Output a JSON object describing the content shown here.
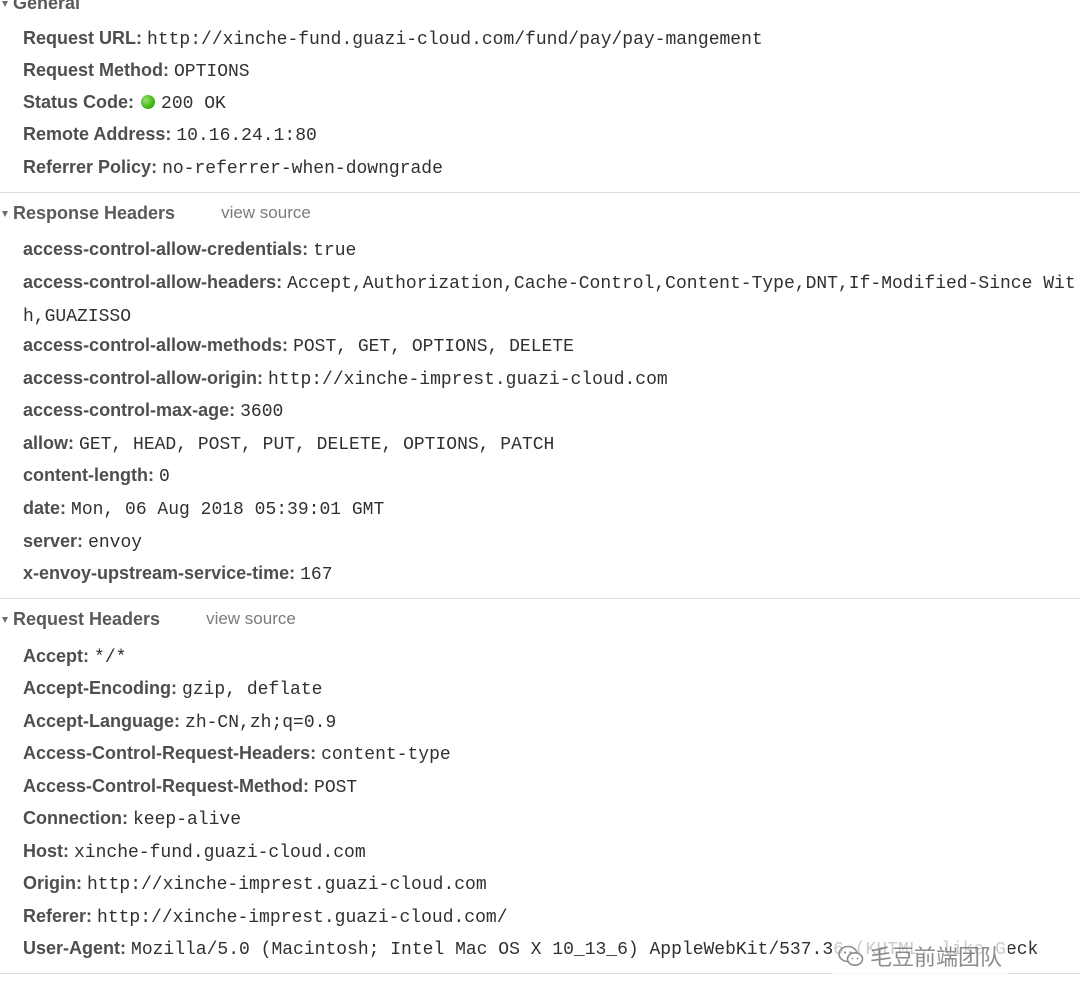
{
  "general": {
    "title": "General",
    "rows": [
      {
        "key": "Request URL:",
        "value": "http://xinche-fund.guazi-cloud.com/fund/pay/pay-mangement"
      },
      {
        "key": "Request Method:",
        "value": "OPTIONS"
      },
      {
        "key": "Status Code:",
        "value": "200 OK"
      },
      {
        "key": "Remote Address:",
        "value": "10.16.24.1:80"
      },
      {
        "key": "Referrer Policy:",
        "value": "no-referrer-when-downgrade"
      }
    ],
    "status_color": "#44b91e"
  },
  "response_headers": {
    "title": "Response Headers",
    "view_source": "view source",
    "rows": [
      {
        "key": "access-control-allow-credentials:",
        "value": "true"
      },
      {
        "key": "access-control-allow-headers:",
        "value": "Accept,Authorization,Cache-Control,Content-Type,DNT,If-Modified-Since With,GUAZISSO"
      },
      {
        "key": "access-control-allow-methods:",
        "value": "POST, GET, OPTIONS, DELETE"
      },
      {
        "key": "access-control-allow-origin:",
        "value": "http://xinche-imprest.guazi-cloud.com"
      },
      {
        "key": "access-control-max-age:",
        "value": "3600"
      },
      {
        "key": "allow:",
        "value": "GET, HEAD, POST, PUT, DELETE, OPTIONS, PATCH"
      },
      {
        "key": "content-length:",
        "value": "0"
      },
      {
        "key": "date:",
        "value": "Mon, 06 Aug 2018 05:39:01 GMT"
      },
      {
        "key": "server:",
        "value": "envoy"
      },
      {
        "key": "x-envoy-upstream-service-time:",
        "value": "167"
      }
    ]
  },
  "request_headers": {
    "title": "Request Headers",
    "view_source": "view source",
    "rows": [
      {
        "key": "Accept:",
        "value": "*/*"
      },
      {
        "key": "Accept-Encoding:",
        "value": "gzip, deflate"
      },
      {
        "key": "Accept-Language:",
        "value": "zh-CN,zh;q=0.9"
      },
      {
        "key": "Access-Control-Request-Headers:",
        "value": "content-type"
      },
      {
        "key": "Access-Control-Request-Method:",
        "value": "POST"
      },
      {
        "key": "Connection:",
        "value": "keep-alive"
      },
      {
        "key": "Host:",
        "value": "xinche-fund.guazi-cloud.com"
      },
      {
        "key": "Origin:",
        "value": "http://xinche-imprest.guazi-cloud.com"
      },
      {
        "key": "Referer:",
        "value": "http://xinche-imprest.guazi-cloud.com/"
      },
      {
        "key": "User-Agent:",
        "value": "Mozilla/5.0 (Macintosh; Intel Mac OS X 10_13_6) AppleWebKit/537.36 (KHTML, like Geck"
      }
    ]
  },
  "watermark": {
    "text": "毛豆前端团队",
    "icon": "wechat-icon"
  }
}
